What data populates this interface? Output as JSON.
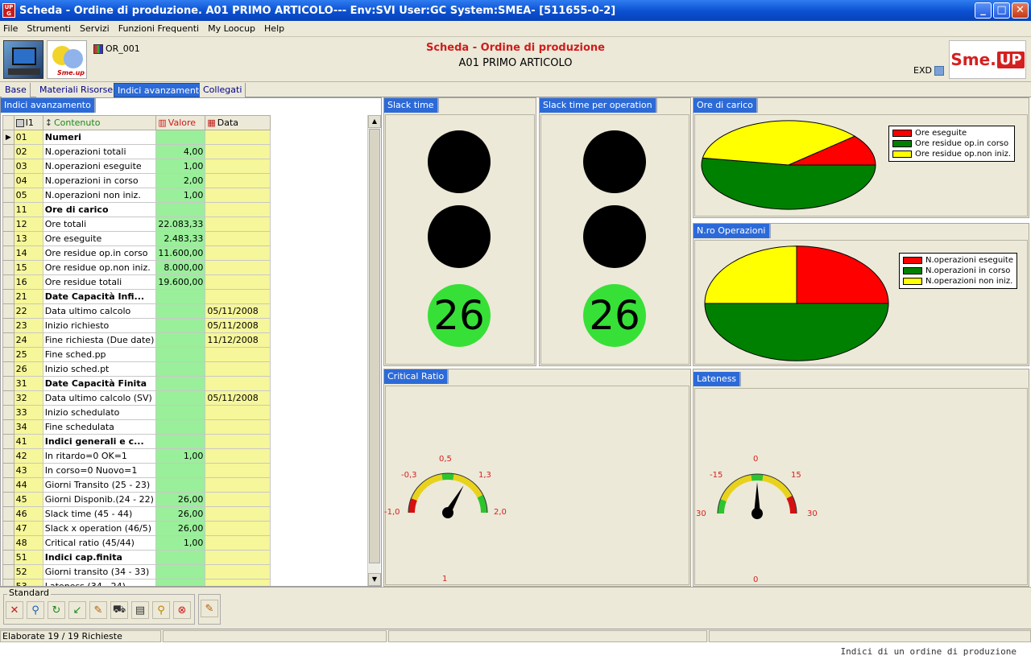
{
  "window": {
    "title": "Scheda - Ordine di produzione. A01 PRIMO ARTICOLO--- Env:SVI User:GC System:SMEA- [511655-0-2]",
    "app_icon_text": "UP G",
    "buttons": {
      "minimize": "_",
      "maximize": "□",
      "close": "✕"
    }
  },
  "menu": [
    "File",
    "Strumenti",
    "Servizi",
    "Funzioni Frequenti",
    "My Loocup",
    "Help"
  ],
  "header": {
    "object_code": "OR_001",
    "title": "Scheda - Ordine di produzione",
    "subtitle": "A01 PRIMO ARTICOLO",
    "exd_label": "EXD",
    "logo_small_text": "Sme.up",
    "brand_left": "Sme.",
    "brand_right": "UP"
  },
  "tabs": [
    "Base",
    "Materiali",
    "Risorse",
    "Indici avanzamento",
    "Collegati"
  ],
  "active_tab": "Indici avanzamento",
  "left_section": {
    "label": "Indici avanzamento",
    "columns": {
      "code": "I1",
      "desc": "Contenuto",
      "value": "Valore",
      "date": "Data"
    },
    "rows": [
      {
        "code": "01",
        "desc": "Numeri",
        "value": "",
        "date": "",
        "bold": true
      },
      {
        "code": "02",
        "desc": "N.operazioni totali",
        "value": "4,00",
        "date": ""
      },
      {
        "code": "03",
        "desc": "N.operazioni eseguite",
        "value": "1,00",
        "date": ""
      },
      {
        "code": "04",
        "desc": "N.operazioni in corso",
        "value": "2,00",
        "date": ""
      },
      {
        "code": "05",
        "desc": "N.operazioni non iniz.",
        "value": "1,00",
        "date": ""
      },
      {
        "code": "11",
        "desc": "Ore di carico",
        "value": "",
        "date": "",
        "bold": true
      },
      {
        "code": "12",
        "desc": "Ore totali",
        "value": "22.083,33",
        "date": ""
      },
      {
        "code": "13",
        "desc": "Ore eseguite",
        "value": "2.483,33",
        "date": ""
      },
      {
        "code": "14",
        "desc": "Ore residue op.in corso",
        "value": "11.600,00",
        "date": ""
      },
      {
        "code": "15",
        "desc": "Ore residue op.non iniz.",
        "value": "8.000,00",
        "date": ""
      },
      {
        "code": "16",
        "desc": "Ore residue totali",
        "value": "19.600,00",
        "date": ""
      },
      {
        "code": "21",
        "desc": "Date Capacità Infi...",
        "value": "",
        "date": "",
        "bold": true
      },
      {
        "code": "22",
        "desc": "Data ultimo calcolo",
        "value": "",
        "date": "05/11/2008"
      },
      {
        "code": "23",
        "desc": "Inizio richiesto",
        "value": "",
        "date": "05/11/2008"
      },
      {
        "code": "24",
        "desc": "Fine richiesta (Due date)",
        "value": "",
        "date": "11/12/2008"
      },
      {
        "code": "25",
        "desc": "Fine sched.pp",
        "value": "",
        "date": ""
      },
      {
        "code": "26",
        "desc": "Inizio sched.pt",
        "value": "",
        "date": ""
      },
      {
        "code": "31",
        "desc": "Date Capacità Finita",
        "value": "",
        "date": "",
        "bold": true
      },
      {
        "code": "32",
        "desc": "Data ultimo calcolo (SV)",
        "value": "",
        "date": "05/11/2008"
      },
      {
        "code": "33",
        "desc": "Inizio schedulato",
        "value": "",
        "date": ""
      },
      {
        "code": "34",
        "desc": "Fine schedulata",
        "value": "",
        "date": ""
      },
      {
        "code": "41",
        "desc": "Indici generali e c...",
        "value": "",
        "date": "",
        "bold": true
      },
      {
        "code": "42",
        "desc": "In ritardo=0   OK=1",
        "value": "1,00",
        "date": ""
      },
      {
        "code": "43",
        "desc": "In corso=0 Nuovo=1",
        "value": "",
        "date": ""
      },
      {
        "code": "44",
        "desc": "Giorni Transito (25 - 23)",
        "value": "",
        "date": ""
      },
      {
        "code": "45",
        "desc": "Giorni Disponib.(24 - 22)",
        "value": "26,00",
        "date": ""
      },
      {
        "code": "46",
        "desc": "Slack time (45 - 44)",
        "value": "26,00",
        "date": ""
      },
      {
        "code": "47",
        "desc": "Slack x operation (46/5)",
        "value": "26,00",
        "date": ""
      },
      {
        "code": "48",
        "desc": "Critical ratio (45/44)",
        "value": "1,00",
        "date": ""
      },
      {
        "code": "51",
        "desc": "Indici cap.finita",
        "value": "",
        "date": "",
        "bold": true
      },
      {
        "code": "52",
        "desc": "Giorni transito (34 - 33)",
        "value": "",
        "date": ""
      },
      {
        "code": "53",
        "desc": "Lateness (34 - 24)",
        "value": "",
        "date": ""
      }
    ],
    "row_marker": "▶"
  },
  "slack_time": {
    "label": "Slack time",
    "value": "26"
  },
  "slack_time_op": {
    "label": "Slack time per operation",
    "value": "26"
  },
  "ore_di_carico": {
    "label": "Ore di carico",
    "legend": [
      "Ore eseguite",
      "Ore residue op.in corso",
      "Ore residue op.non iniz."
    ]
  },
  "nro_operazioni": {
    "label": "N.ro Operazioni",
    "legend": [
      "N.operazioni eseguite",
      "N.operazioni in corso",
      "N.operazioni non iniz."
    ]
  },
  "critical_ratio": {
    "label": "Critical Ratio",
    "ticks": [
      "-1,0",
      "-0,3",
      "0,5",
      "1,3",
      "2,0"
    ],
    "value_label": "1"
  },
  "lateness": {
    "label": "Lateness",
    "ticks": [
      "30",
      "-15",
      "0",
      "15",
      "30"
    ],
    "value_label": "0"
  },
  "chart_data": [
    {
      "type": "pie",
      "title": "Ore di carico",
      "categories": [
        "Ore eseguite",
        "Ore residue op.in corso",
        "Ore residue op.non iniz."
      ],
      "values": [
        2483.33,
        11600.0,
        8000.0
      ],
      "colors": [
        "#ff0000",
        "#008000",
        "#ffff00"
      ],
      "legend": "top-right"
    },
    {
      "type": "pie",
      "title": "N.ro Operazioni",
      "categories": [
        "N.operazioni eseguite",
        "N.operazioni in corso",
        "N.operazioni non iniz."
      ],
      "values": [
        1,
        2,
        1
      ],
      "colors": [
        "#ff0000",
        "#008000",
        "#ffff00"
      ],
      "legend": "top-right"
    }
  ],
  "gauges": {
    "critical_ratio": {
      "min": -1.0,
      "max": 2.0,
      "value": 1.0
    },
    "lateness": {
      "min": -30,
      "max": 30,
      "value": 0
    }
  },
  "toolbar": {
    "group_label": "Standard",
    "buttons": [
      {
        "name": "close-button",
        "icon": "✕",
        "color": "#d01818"
      },
      {
        "name": "find-button",
        "icon": "⚲",
        "color": "#1a5fb4"
      },
      {
        "name": "refresh-button",
        "icon": "↻",
        "color": "#1a8a1a"
      },
      {
        "name": "back-button",
        "icon": "↙",
        "color": "#1a8a1a"
      },
      {
        "name": "edit-button",
        "icon": "✎",
        "color": "#b35c00"
      },
      {
        "name": "cart-button",
        "icon": "⛟",
        "color": "#333333"
      },
      {
        "name": "export-button",
        "icon": "▤",
        "color": "#333333"
      },
      {
        "name": "zoom-button",
        "icon": "⚲",
        "color": "#c08000"
      },
      {
        "name": "stop-button",
        "icon": "⊗",
        "color": "#d01818"
      }
    ],
    "extra_icon": "✎"
  },
  "status": {
    "left": "Elaborate 19 / 19 Richieste"
  },
  "caption": "Indici di un ordine di produzione",
  "colors": {
    "accent": "#2c6ad8",
    "value_col": "#9aef9a",
    "date_col": "#f6f69a",
    "gauge_label": "#d62020"
  }
}
